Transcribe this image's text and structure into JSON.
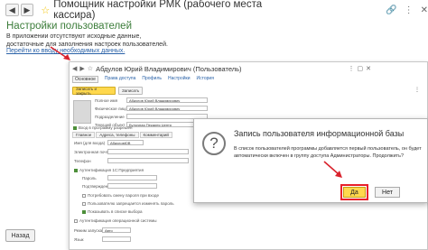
{
  "window": {
    "title": "Помощник настройки РМК (рабочего места кассира)",
    "back_icon": "arrow-left-icon",
    "forward_icon": "arrow-right-icon",
    "favorite_icon": "star-icon"
  },
  "main": {
    "heading": "Настройки пользователей",
    "info_text": "В приложении отсутствуют исходные данные, достаточные для заполнения настроек пользователей.",
    "link_text": "Перейти ко вводу необходимых данных.",
    "back_button": "Назад"
  },
  "user_form": {
    "title": "Абдулов Юрий Владимирович (Пользователь)",
    "tabs": [
      "Основное",
      "Права доступа",
      "Профиль",
      "Настройки",
      "История"
    ],
    "toolbar": {
      "save_close": "Записать и закрыть",
      "write": "Записать"
    },
    "fields": [
      {
        "label": "Полное имя",
        "value": "Абдулов Юрий Владимирович"
      },
      {
        "label": "Физическое лицо",
        "value": "Абдулов Юрий Владимирович"
      },
      {
        "label": "Подразделение",
        "value": ""
      },
      {
        "label": "Текущий объект",
        "value": "Булочная Пекарня Центр"
      }
    ],
    "access_checkbox": "Вход в программу разрешен",
    "subtabs": [
      "Главное",
      "Адреса, телефоны",
      "Комментарий"
    ],
    "auth": {
      "login_label": "Имя (для входа)",
      "login_value": "АбдуловЮВ",
      "email_label": "Электронная почта",
      "phone_label": "Телефон",
      "auth_1c": "Аутентификация 1С:Предприятия",
      "password_label": "Пароль",
      "confirm_label": "Подтверждение",
      "require_change": "Потребовать смену пароля при входе",
      "cannot_change": "Пользователю запрещается изменять пароль",
      "show_in_list": "Показывать в списке выбора",
      "os_auth": "Аутентификация операционной системы",
      "run_mode_label": "Режим запуска",
      "run_mode_value": "Авто",
      "language_label": "Язык"
    }
  },
  "dialog": {
    "title": "Запись пользователя информационной базы",
    "message": "В список пользователей программы добавляется первый пользователь, он будет автоматически включен в группу доступа Администраторы. Продолжить?",
    "yes": "Да",
    "no": "Нет",
    "highlight_color": "#e8202a",
    "question_icon": "question-icon"
  },
  "colors": {
    "accent_green": "#3c7d3a",
    "primary_button": "#ffd84d",
    "link_blue": "#2a62a8",
    "arrow_red": "#d9232d"
  }
}
